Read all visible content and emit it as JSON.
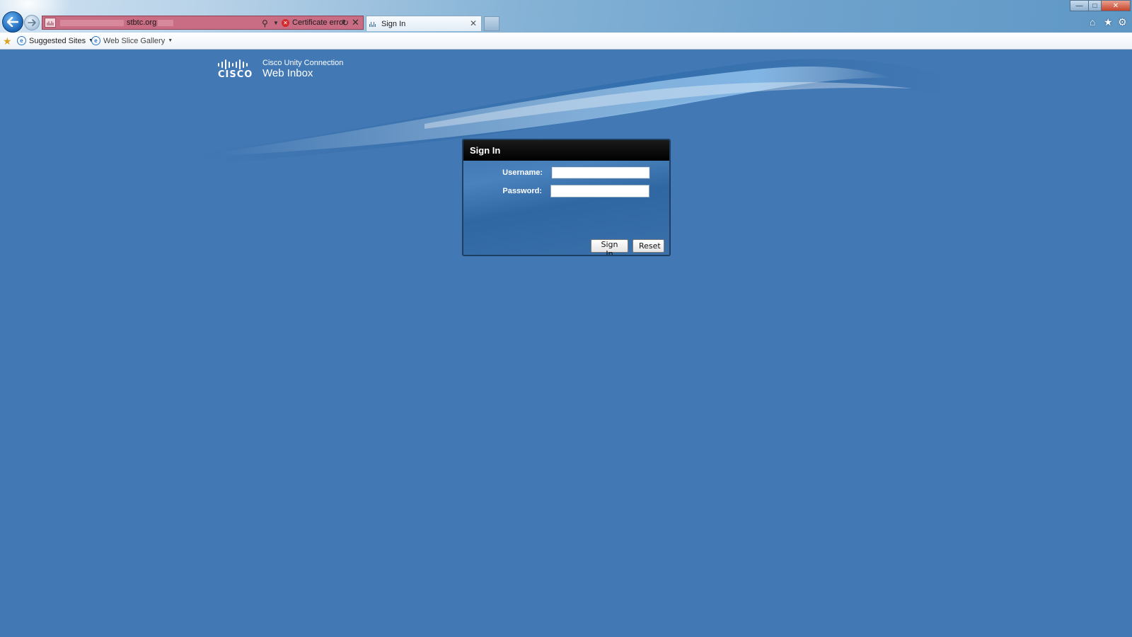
{
  "browser": {
    "address_bar": {
      "url_visible": "stbtc.org",
      "security_label": "Certificate error"
    },
    "tab": {
      "label": "Sign In"
    },
    "favorites_bar": {
      "items": [
        {
          "label": "Suggested Sites"
        },
        {
          "label": "Web Slice Gallery"
        }
      ]
    },
    "window_controls": {
      "minimize": "—",
      "maximize": "□",
      "close": "✕"
    }
  },
  "page": {
    "brand": {
      "logo_word": "CISCO",
      "subtitle": "Cisco Unity Connection",
      "title": "Web Inbox"
    },
    "signin": {
      "header": "Sign In",
      "username_label": "Username:",
      "username_value": "",
      "password_label": "Password:",
      "password_value": "",
      "signin_button": "Sign In",
      "reset_button": "Reset"
    }
  },
  "colors": {
    "page_background": "#4279b5",
    "panel_header": "#000000",
    "certificate_error_bar": "#c96d84"
  },
  "icons": [
    "back-arrow-icon",
    "forward-arrow-icon",
    "search-icon",
    "dropdown-icon",
    "certificate-error-icon",
    "refresh-icon",
    "stop-icon",
    "tab-close-icon",
    "home-icon",
    "favorites-star-icon",
    "tools-gear-icon",
    "add-favorites-icon",
    "ie-page-icon"
  ]
}
